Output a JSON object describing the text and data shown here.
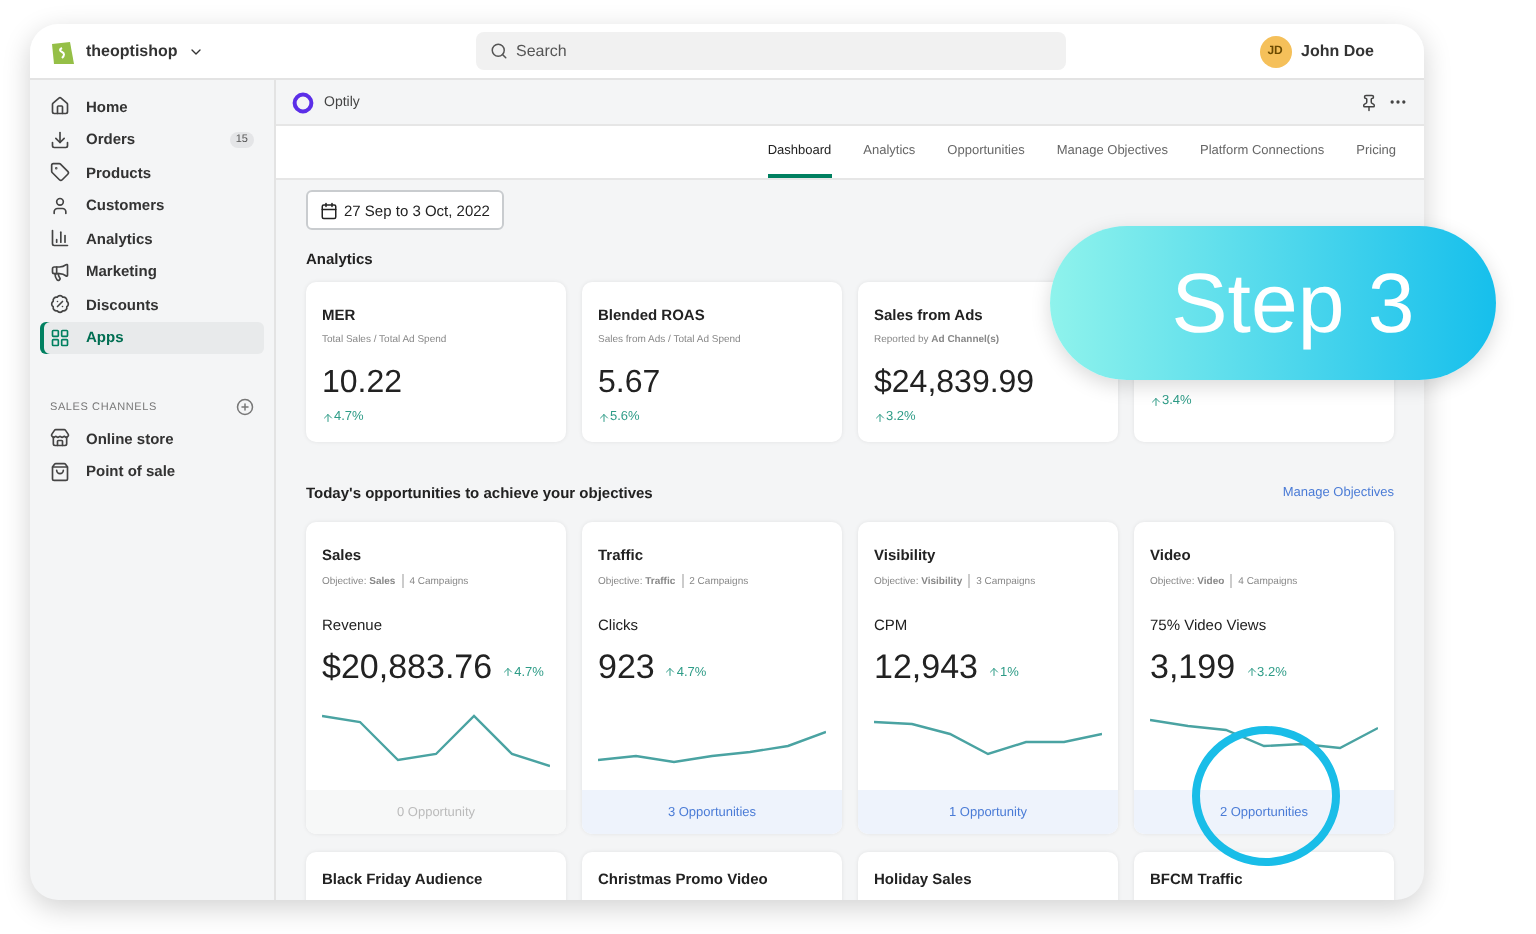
{
  "topbar": {
    "store": "theoptishop",
    "search": {
      "placeholder": "Search"
    },
    "user": {
      "initials": "JD",
      "name": "John Doe"
    }
  },
  "sidebar": {
    "items": [
      {
        "label": "Home",
        "selected": false
      },
      {
        "label": "Orders",
        "badge": "15",
        "selected": false
      },
      {
        "label": "Products",
        "selected": false
      },
      {
        "label": "Customers",
        "selected": false
      },
      {
        "label": "Analytics",
        "selected": false
      },
      {
        "label": "Marketing",
        "selected": false
      },
      {
        "label": "Discounts",
        "selected": false
      },
      {
        "label": "Apps",
        "selected": true
      }
    ],
    "channels_heading": "SALES CHANNELS",
    "channels": [
      {
        "label": "Online store"
      },
      {
        "label": "Point of sale"
      }
    ]
  },
  "app": {
    "name": "Optily"
  },
  "tabs": [
    {
      "label": "Dashboard",
      "selected": true
    },
    {
      "label": "Analytics",
      "selected": false
    },
    {
      "label": "Opportunities",
      "selected": false
    },
    {
      "label": "Manage Objectives",
      "selected": false
    },
    {
      "label": "Platform Connections",
      "selected": false
    },
    {
      "label": "Pricing",
      "selected": false
    }
  ],
  "date_range": "27 Sep to 3 Oct, 2022",
  "analytics": {
    "heading": "Analytics",
    "cards": [
      {
        "title": "MER",
        "subtitle": "Total Sales / Total Ad Spend",
        "value": "10.22",
        "change": "4.7%"
      },
      {
        "title": "Blended ROAS",
        "subtitle": "Sales from Ads / Total Ad Spend",
        "value": "5.67",
        "change": "5.6%"
      },
      {
        "title": "Sales from Ads",
        "subtitle": "Reported by **Ad Channel(s)**",
        "value": "$24,839.99",
        "change": "3.2%"
      },
      {
        "change": "3.4%"
      }
    ]
  },
  "opportunities": {
    "heading": "Today's opportunities to achieve your objectives",
    "link": "Manage Objectives",
    "cards": [
      {
        "title": "Sales",
        "objective": "Objective: **Sales**",
        "campaigns": "4 Campaigns",
        "metric": "Revenue",
        "value": "$20,883.76",
        "change": "4.7%",
        "footer": "0 Opportunity",
        "active": false
      },
      {
        "title": "Traffic",
        "objective": "Objective: **Traffic**",
        "campaigns": "2 Campaigns",
        "metric": "Clicks",
        "value": "923",
        "change": "4.7%",
        "footer": "3 Opportunities",
        "active": true
      },
      {
        "title": "Visibility",
        "objective": "Objective: **Visibility**",
        "campaigns": "3 Campaigns",
        "metric": "CPM",
        "value": "12,943",
        "change": "1%",
        "footer": "1 Opportunity",
        "active": true
      },
      {
        "title": "Video",
        "objective": "Objective: **Video**",
        "campaigns": "4 Campaigns",
        "metric": "75% Video Views",
        "value": "3,199",
        "change": "3.2%",
        "footer": "2 Opportunities",
        "active": true
      }
    ],
    "more": [
      "Black Friday Audience",
      "Christmas Promo Video",
      "Holiday Sales",
      "BFCM Traffic"
    ]
  },
  "callout": {
    "label": "Step 3"
  }
}
